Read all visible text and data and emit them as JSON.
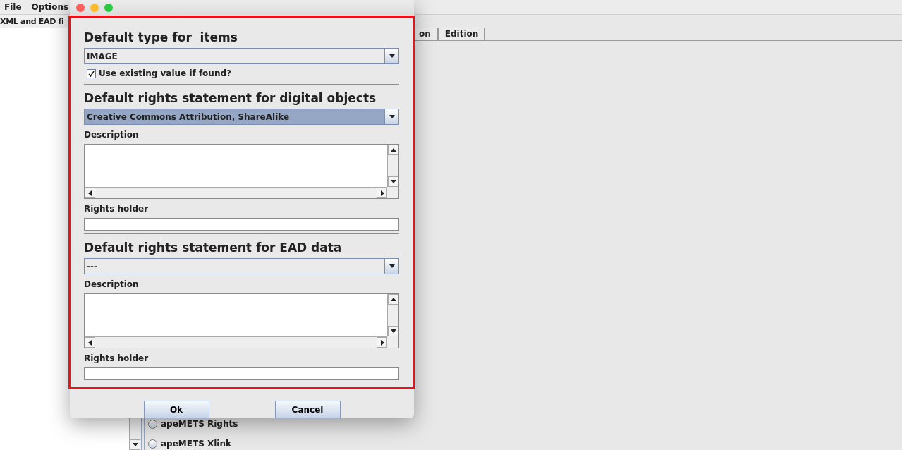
{
  "menu": [
    "File",
    "Options"
  ],
  "left_tab": {
    "label": "XML and EAD fi"
  },
  "right_tabs": [
    "on",
    "Edition"
  ],
  "options": [
    {
      "label": "apeMETS Rights",
      "selected": false
    },
    {
      "label": "apeMETS Xlink",
      "selected": false
    }
  ],
  "dialog": {
    "type_section": {
      "heading": "Default type for  items",
      "value": "IMAGE",
      "highlighted": false,
      "checkbox": {
        "label": "Use existing value if found?",
        "checked": true
      }
    },
    "rights_sections": [
      {
        "heading": "Default rights statement for digital objects",
        "value": "Creative Commons Attribution, ShareAlike",
        "highlighted": true,
        "description_label": "Description",
        "holder_label": "Rights holder"
      },
      {
        "heading": "Default rights statement for EAD data",
        "value": "---",
        "highlighted": false,
        "description_label": "Description",
        "holder_label": "Rights holder"
      }
    ],
    "buttons": [
      "Ok",
      "Cancel"
    ]
  }
}
